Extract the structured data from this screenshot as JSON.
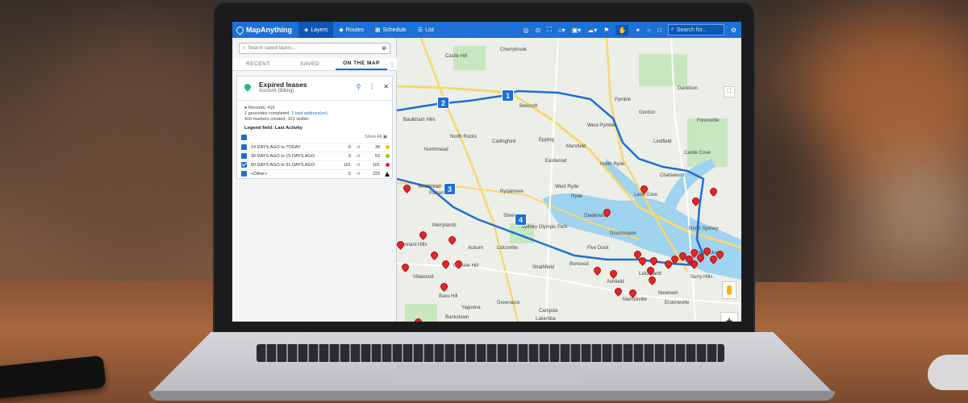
{
  "app": {
    "logo_text": "MapAnything",
    "nav": [
      {
        "label": "Layers",
        "icon": "layers-icon"
      },
      {
        "label": "Routes",
        "icon": "routes-icon"
      },
      {
        "label": "Schedule",
        "icon": "calendar-icon"
      },
      {
        "label": "List",
        "icon": "list-icon"
      }
    ],
    "search_placeholder": "Search for..."
  },
  "panel": {
    "search_placeholder": "Search saved layers...",
    "tabs": [
      "RECENT",
      "SAVED",
      "ON THE MAP"
    ],
    "active_tab": "ON THE MAP",
    "layer": {
      "title": "Expired leases",
      "subtitle": "Account (Billing)",
      "records": "Records: 416",
      "geocodes_prefix": "1 geocodes completed.",
      "bad_address_link": "1 bad address(es).",
      "markers": "416 markers created. 101 visible.",
      "legend_field": "Legend field: Last Activity",
      "show_all": "Show All",
      "legend_rows": [
        {
          "label": "14 DAYS AGO to TODAY",
          "visible": "0",
          "of": "of",
          "total": "39",
          "color": "#f1c40f",
          "checked": false
        },
        {
          "label": "30 DAYS AGO to 15 DAYS AGO",
          "visible": "0",
          "of": "of",
          "total": "53",
          "color": "#8bc34a",
          "checked": false
        },
        {
          "label": "60 DAYS AGO to 31 DAYS AGO",
          "visible": "101",
          "of": "of",
          "total": "101",
          "color": "#e52626",
          "checked": true
        },
        {
          "label": "<Other>",
          "visible": "0",
          "of": "of",
          "total": "223",
          "color": "#111111",
          "checked": false
        }
      ]
    }
  },
  "map": {
    "labels": [
      "Castle Hill",
      "Cherrybrook",
      "Beecroft",
      "Pymble",
      "Davidson",
      "Baulkham Hills",
      "North Rocks",
      "Carlingford",
      "West Pymble",
      "Lindfield",
      "Northmead",
      "Epping",
      "Marsfield",
      "Castle Cove",
      "Eastwood",
      "North Ryde",
      "Chatswood",
      "Westmead",
      "Parramatta",
      "Rydalmere",
      "West Ryde",
      "Lane Cove",
      "Ryde",
      "Gladesville",
      "Silverwater",
      "Sydney Olympic Park",
      "Merrylands",
      "North Sydney",
      "Auburn",
      "Lidcombe",
      "Five Dock",
      "Drummoyne",
      "Pennant Hills",
      "Chester Hill",
      "Villawood",
      "Strathfield",
      "Burwood",
      "Ashfield",
      "Leichhardt",
      "Newtown",
      "Bass Hill",
      "Marrickville",
      "Erskineville",
      "Yagoona",
      "Greenacre",
      "Campsie",
      "Lakemba",
      "Bankstown",
      "The Rocks",
      "Surry Hills",
      "Forestville",
      "Gordon"
    ],
    "route_stops": [
      "1",
      "2",
      "3",
      "4"
    ],
    "zoom_in": "+"
  },
  "colors": {
    "brand": "#1e6fd6",
    "brand_dark": "#0f56b5",
    "marker": "#e52626",
    "layer_pin": "#2bb58a"
  }
}
